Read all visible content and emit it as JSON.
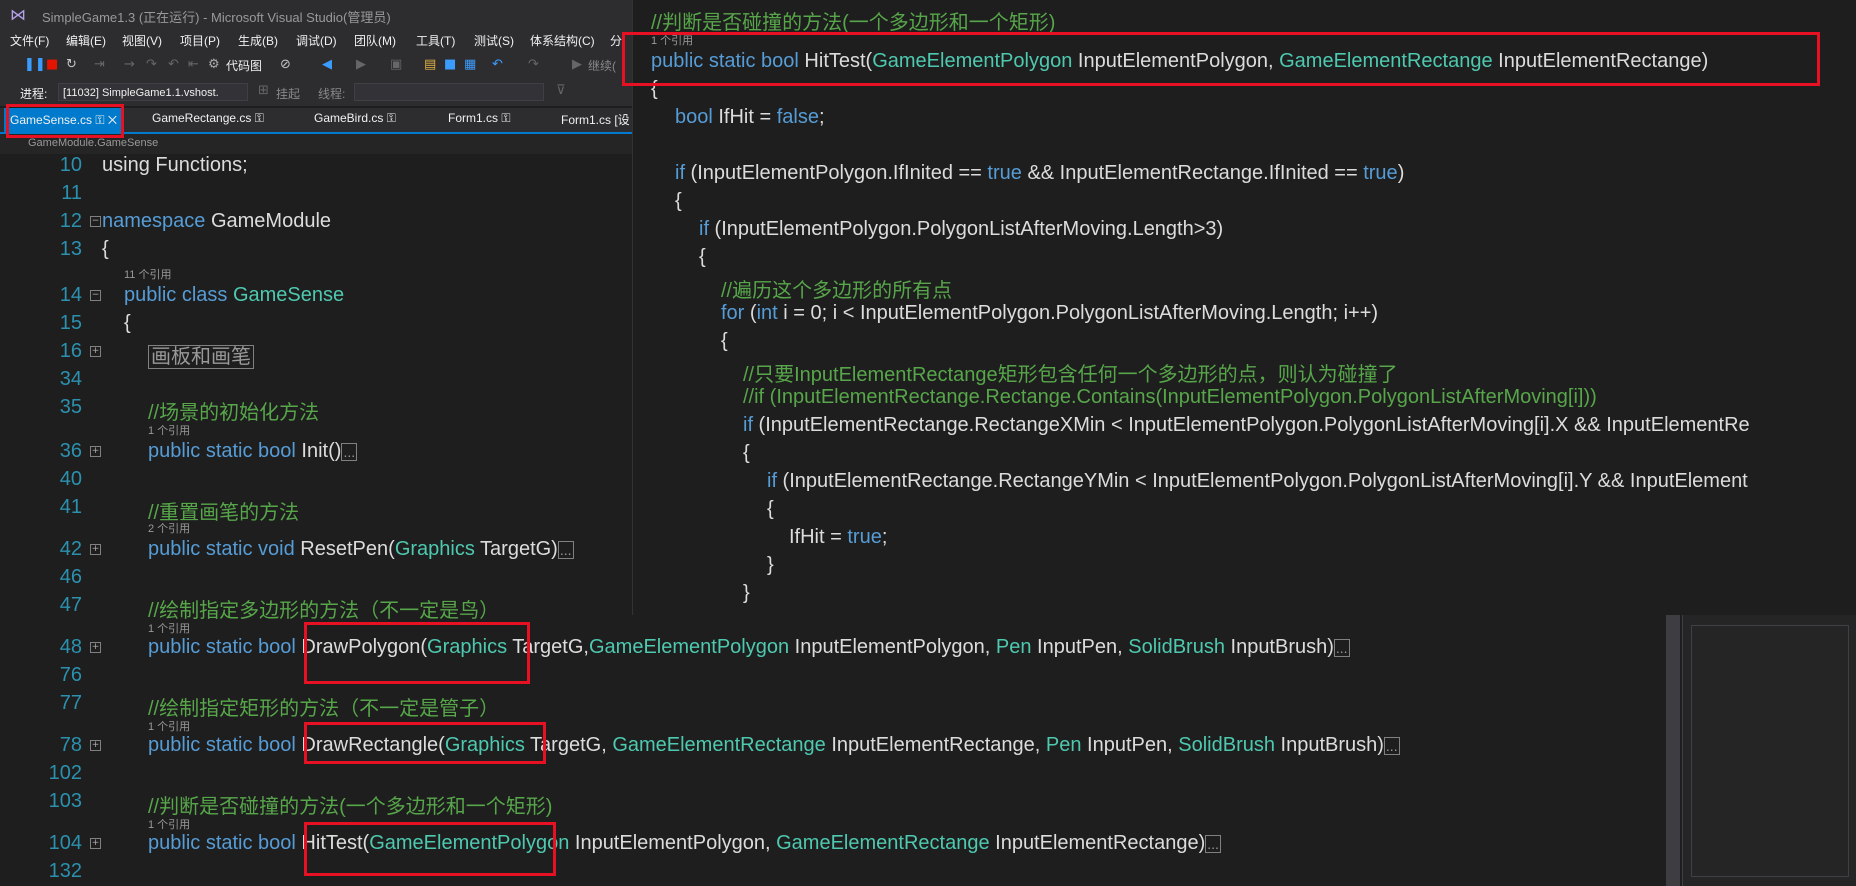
{
  "window": {
    "title": "SimpleGame1.3 (正在运行) - Microsoft Visual Studio(管理员)"
  },
  "menu": [
    "文件(F)",
    "编辑(E)",
    "视图(V)",
    "项目(P)",
    "生成(B)",
    "调试(D)",
    "团队(M)",
    "工具(T)",
    "测试(S)",
    "体系结构(C)",
    "分"
  ],
  "toolbar": {
    "code_map_label": "代码图",
    "continue_label": "继续("
  },
  "debug_bar": {
    "process_label": "进程:",
    "process_value": "[11032] SimpleGame1.1.vshost.",
    "suspend_label": "挂起",
    "thread_label": "线程:"
  },
  "tabs": [
    "GameSense.cs",
    "GameRectange.cs",
    "GameBird.cs",
    "Form1.cs",
    "Form1.cs [设"
  ],
  "nav": {
    "path": "GameModule.GameSense"
  },
  "editor": {
    "lines": [
      {
        "ln": "10",
        "code": "using Functions;"
      },
      {
        "ln": "11",
        "code": ""
      },
      {
        "ln": "12",
        "kw": "namespace",
        "rest": " GameModule"
      },
      {
        "ln": "13",
        "code": "{"
      },
      {
        "ln": "14",
        "refs": "11 个引用",
        "kw": "public class",
        "ty": " GameSense"
      },
      {
        "ln": "15",
        "code": "{"
      },
      {
        "ln": "16",
        "region": "画板和画笔"
      },
      {
        "ln": "34",
        "code": ""
      },
      {
        "ln": "35",
        "comment": "//场景的初始化方法"
      },
      {
        "ln": "36",
        "refs": "1 个引用",
        "kw": "public static bool",
        "rest": " Init()"
      },
      {
        "ln": "40",
        "code": ""
      },
      {
        "ln": "41",
        "comment": "//重置画笔的方法"
      },
      {
        "ln": "42",
        "refs": "2 个引用",
        "kw": "public static void",
        "rest": " ResetPen(",
        "ty": "Graphics",
        "rest2": " TargetG)"
      },
      {
        "ln": "46",
        "code": ""
      },
      {
        "ln": "47",
        "comment": "//绘制指定多边形的方法（不一定是鸟）"
      },
      {
        "ln": "48",
        "refs": "1 个引用",
        "kw": "public static bool",
        "m": " DrawPolygon(",
        "t1": "Graphics",
        "a1": " TargetG,",
        "t2": "GameElementPolygon",
        "a2": " InputElementPolygon, ",
        "t3": "Pen",
        "a3": " InputPen, ",
        "t4": "SolidBrush",
        "a4": " InputBrush)"
      },
      {
        "ln": "76",
        "code": ""
      },
      {
        "ln": "77",
        "comment": "//绘制指定矩形的方法（不一定是管子）"
      },
      {
        "ln": "78",
        "refs": "1 个引用",
        "kw": "public static bool",
        "m": " DrawRectangle(",
        "t1": "Graphics",
        "a1": " TargetG, ",
        "t2": "GameElementRectange",
        "a2": " InputElementRectange, ",
        "t3": "Pen",
        "a3": " InputPen, ",
        "t4": "SolidBrush",
        "a4": " InputBrush)"
      },
      {
        "ln": "102",
        "code": ""
      },
      {
        "ln": "103",
        "comment": "//判断是否碰撞的方法(一个多边形和一个矩形)"
      },
      {
        "ln": "104",
        "refs": "1 个引用",
        "kw": "public static bool",
        "m": " HitTest(",
        "t1": "GameElementPolygon",
        "a1": " InputElementPolygon, ",
        "t2": "GameElementRectange",
        "a2": " InputElementRectange)"
      },
      {
        "ln": "132",
        "code": ""
      }
    ]
  },
  "popup": {
    "comment1": "//判断是否碰撞的方法(一个多边形和一个矩形)",
    "refs": "1 个引用",
    "sig_kw": "public static bool",
    "sig_m": " HitTest(",
    "sig_t1": "GameElementPolygon",
    "sig_a1": " InputElementPolygon, ",
    "sig_t2": "GameElementRectange",
    "sig_a2": " InputElementRectange)",
    "l_brace": "{",
    "l_bool_kw": "bool",
    "l_bool_rest": " IfHit = ",
    "l_bool_false": "false",
    "l_bool_end": ";",
    "l_if1_kw": "if",
    "l_if1_a": " (InputElementPolygon.IfInited == ",
    "l_if1_true1": "true",
    "l_if1_b": " && InputElementRectange.IfInited == ",
    "l_if1_true2": "true",
    "l_if1_c": ")",
    "l_brace2": "{",
    "l_if2_kw": "if",
    "l_if2_rest": " (InputElementPolygon.PolygonListAfterMoving.Length>3)",
    "l_brace3": "{",
    "l_cm_loop": "//遍历这个多边形的所有点",
    "l_for_kw": "for",
    "l_for_a": " (",
    "l_for_int": "int",
    "l_for_b": " i = 0; i < InputElementPolygon.PolygonListAfterMoving.Length; i++)",
    "l_brace4": "{",
    "l_cm_contains": "//只要InputElementRectange矩形包含任何一个多边形的点，则认为碰撞了",
    "l_cm_if": "//if (InputElementRectange.Rectange.Contains(InputElementPolygon.PolygonListAfterMoving[i]))",
    "l_if3_kw": "if",
    "l_if3_rest": " (InputElementRectange.RectangeXMin < InputElementPolygon.PolygonListAfterMoving[i].X && InputElementRe",
    "l_brace5": "{",
    "l_if4_kw": "if",
    "l_if4_rest": " (InputElementRectange.RectangeYMin < InputElementPolygon.PolygonListAfterMoving[i].Y && InputElement",
    "l_brace6": "{",
    "l_hit": "IfHit = ",
    "l_hit_true": "true",
    "l_hit_end": ";",
    "l_close1": "}",
    "l_close2": "}"
  }
}
